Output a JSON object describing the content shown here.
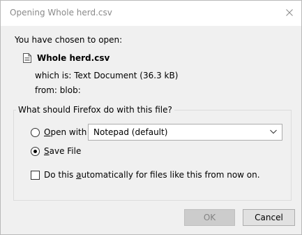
{
  "window": {
    "title": "Opening Whole herd.csv"
  },
  "prompt": "You have chosen to open:",
  "file": {
    "name": "Whole herd.csv",
    "which_is_label": "which is:",
    "which_is_value": "Text Document (36.3 kB)",
    "from_label": "from:",
    "from_value": "blob:"
  },
  "options": {
    "legend": "What should Firefox do with this file?",
    "open_with": {
      "label_pre": "",
      "label_accel": "O",
      "label_post": "pen with",
      "selected": false,
      "app": "Notepad (default)"
    },
    "save_file": {
      "label_accel": "S",
      "label_post": "ave File",
      "selected": true
    },
    "auto": {
      "label_pre": "Do this ",
      "label_accel": "a",
      "label_post": "utomatically for files like this from now on.",
      "checked": false
    }
  },
  "buttons": {
    "ok": "OK",
    "cancel": "Cancel"
  },
  "icons": {
    "close": "close-icon",
    "file": "file-icon",
    "dropdown": "chevron-down-icon"
  }
}
